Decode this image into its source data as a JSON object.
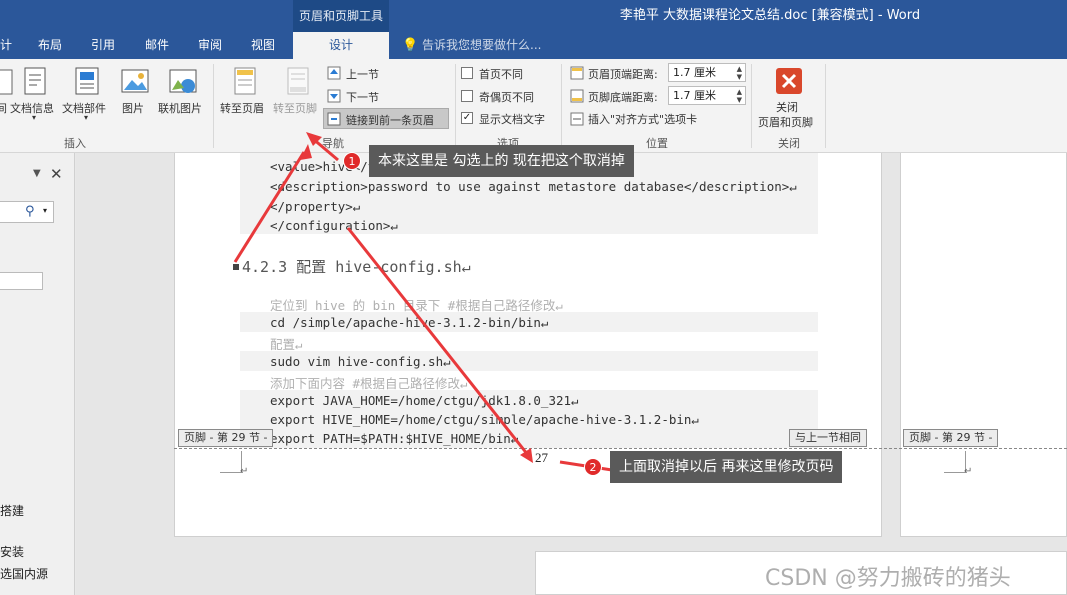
{
  "window": {
    "title": "李艳平 大数据课程论文总结.doc [兼容模式] - Word",
    "tool_header": "页眉和页脚工具"
  },
  "tabs": [
    "计",
    "布局",
    "引用",
    "邮件",
    "审阅",
    "视图",
    "设计"
  ],
  "tell_me": "告诉我您想要做什么...",
  "ribbon": {
    "insert": {
      "items": [
        "间",
        "文档信息",
        "文档部件",
        "图片",
        "联机图片"
      ],
      "group_label": "插入"
    },
    "navigation": {
      "goto_header": "转至页眉",
      "goto_footer": "转至页脚",
      "prev_section": "上一节",
      "next_section": "下一节",
      "link_prev": "链接到前一条页眉",
      "group_label": "导航"
    },
    "options": {
      "diff_first": "首页不同",
      "diff_odd_even": "奇偶页不同",
      "show_doc_text": "显示文档文字",
      "group_label": "选项"
    },
    "position": {
      "header_from_top_label": "页眉顶端距离:",
      "header_from_top_value": "1.7 厘米",
      "footer_from_bottom_label": "页脚底端距离:",
      "footer_from_bottom_value": "1.7 厘米",
      "insert_align_tab": "插入\"对齐方式\"选项卡",
      "group_label": "位置"
    },
    "close": {
      "button": "关闭\n页眉和页脚",
      "button_line1": "关闭",
      "button_line2": "页眉和页脚",
      "group_label": "关闭"
    }
  },
  "left_pane": {
    "items": [
      "搭建",
      "安装",
      "选国内源"
    ]
  },
  "document": {
    "code_lines_top": [
      "<value>hive</value>↵",
      "<description>password to use against metastore database</description>↵",
      "</property>↵",
      "</configuration>↵"
    ],
    "heading": "4.2.3 配置 hive-config.sh↵",
    "body_lines": [
      {
        "text": "定位到 hive 的 bin 目录下 #根据自己路径修改↵",
        "grey": true
      },
      {
        "text": "cd /simple/apache-hive-3.1.2-bin/bin↵",
        "grey": false
      },
      {
        "text": "配置↵",
        "grey": true
      },
      {
        "text": "sudo vim hive-config.sh↵",
        "grey": false
      },
      {
        "text": "添加下面内容 #根据自己路径修改↵",
        "grey": true
      },
      {
        "text": "export JAVA_HOME=/home/ctgu/jdk1.8.0_321↵",
        "grey": false
      },
      {
        "text": "export HIVE_HOME=/home/ctgu/simple/apache-hive-3.1.2-bin↵",
        "grey": false
      },
      {
        "text": "export PATH=$PATH:$HIVE_HOME/bin↵",
        "grey": false
      }
    ],
    "footer_tag_left": "页脚 - 第 29 节 -",
    "footer_tag_same": "与上一节相同",
    "footer_tag_right": "页脚 - 第 29 节 -",
    "page_number": "27",
    "para_mark": "↵"
  },
  "annotations": {
    "callout1": {
      "badge": "1",
      "text": "本来这里是 勾选上的 现在把这个取消掉"
    },
    "callout2": {
      "badge": "2",
      "text": "上面取消掉以后 再来这里修改页码"
    },
    "arrow_color": "#e8393b"
  },
  "watermark": "CSDN @努力搬砖的猪头",
  "colors": {
    "word_blue": "#2b579a",
    "ribbon_bg": "#f3f3f3"
  }
}
